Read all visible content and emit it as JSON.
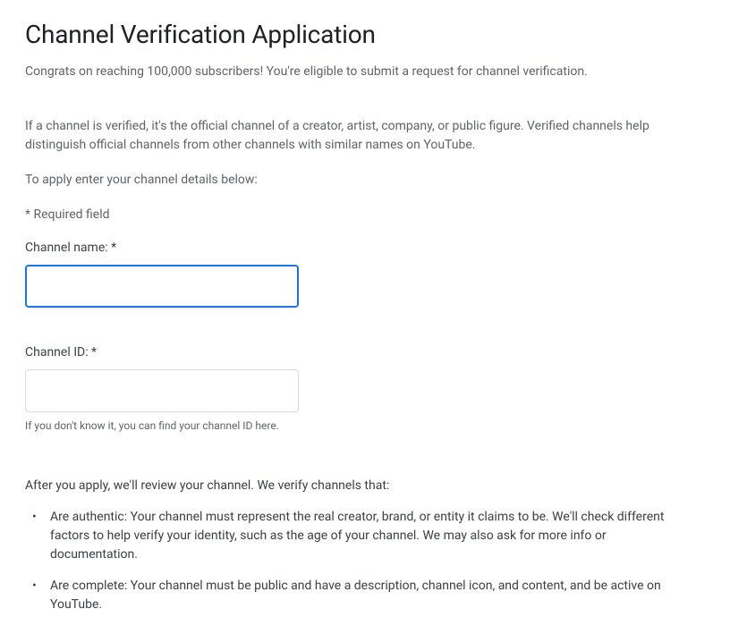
{
  "title": "Channel Verification Application",
  "intro": "Congrats on reaching 100,000 subscribers! You're eligible to submit a request for channel verification.",
  "description": "If a channel is verified, it's the official channel of a creator, artist, company, or public figure. Verified channels help distinguish official channels from other channels with similar names on YouTube.",
  "apply_line": "To apply enter your channel details below:",
  "required_note": "* Required field",
  "fields": {
    "channel_name": {
      "label": "Channel name: *",
      "value": ""
    },
    "channel_id": {
      "label": "Channel ID: *",
      "value": "",
      "helper": "If you don't know it, you can find your channel ID here."
    }
  },
  "review": {
    "intro": "After you apply, we'll review your channel. We verify channels that:",
    "criteria": [
      "Are authentic: Your channel must represent the real creator, brand, or entity it claims to be. We'll check different factors to help verify your identity, such as the age of your channel. We may also ask for more info or documentation.",
      "Are complete: Your channel must be public and have a description, channel icon, and content, and be active on YouTube."
    ]
  }
}
